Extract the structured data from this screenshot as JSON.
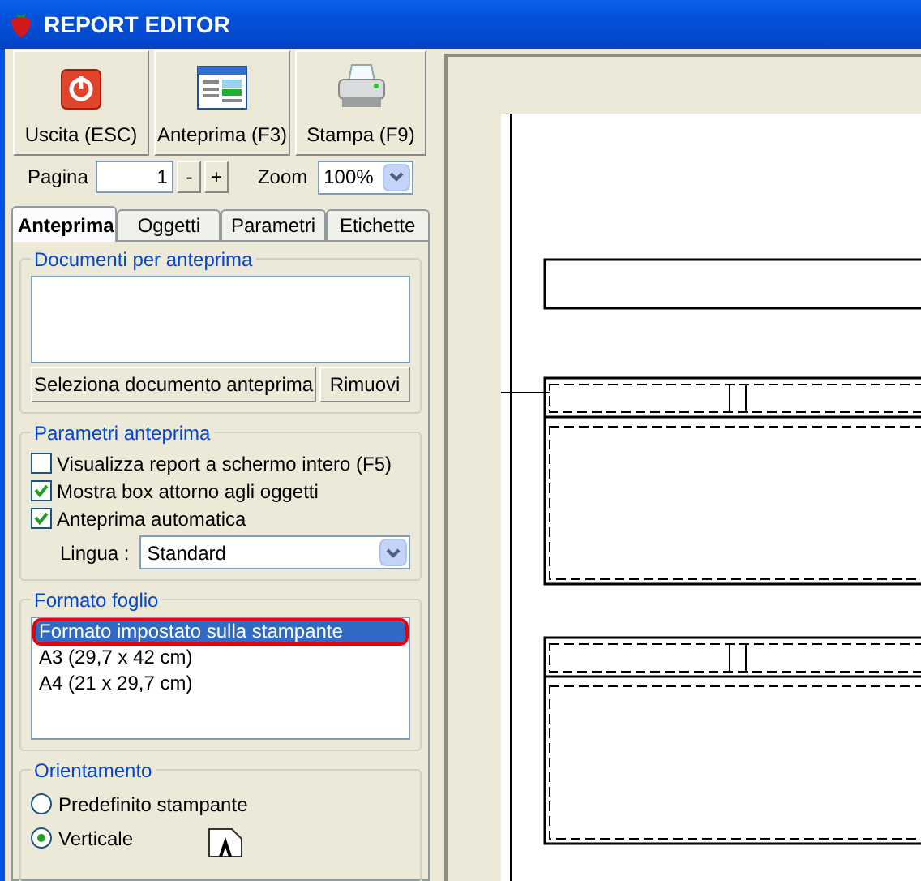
{
  "window": {
    "title": "REPORT EDITOR"
  },
  "toolbar": [
    {
      "kind": "exit",
      "label": "Uscita (ESC)"
    },
    {
      "kind": "preview",
      "label": "Anteprima (F3)"
    },
    {
      "kind": "print",
      "label": "Stampa (F9)"
    }
  ],
  "page_field": {
    "label": "Pagina",
    "value": "1",
    "decrement": "-",
    "increment": "+"
  },
  "zoom": {
    "label": "Zoom",
    "value": "100%"
  },
  "tabs": [
    {
      "label": "Anteprima",
      "selected": true
    },
    {
      "label": "Oggetti",
      "selected": false
    },
    {
      "label": "Parametri",
      "selected": false
    },
    {
      "label": "Etichette",
      "selected": false
    }
  ],
  "documents": {
    "title": "Documenti per anteprima",
    "buttons": [
      "Seleziona documento anteprima",
      "Rimuovi"
    ]
  },
  "preview_params": {
    "title": "Parametri anteprima",
    "options": [
      {
        "label": "Visualizza report a schermo intero (F5)",
        "checked": false
      },
      {
        "label": "Mostra box attorno agli oggetti",
        "checked": true
      },
      {
        "label": "Anteprima automatica",
        "checked": true
      }
    ],
    "language": {
      "label": "Lingua :",
      "value": "Standard"
    }
  },
  "sheet_format": {
    "title": "Formato foglio",
    "items": [
      {
        "label": "Formato impostato sulla stampante",
        "selected": true,
        "highlighted": true
      },
      {
        "label": "A3 (29,7 x 42 cm)",
        "selected": false,
        "highlighted": false
      },
      {
        "label": "A4 (21 x 29,7 cm)",
        "selected": false,
        "highlighted": false
      }
    ]
  },
  "orientation": {
    "title": "Orientamento",
    "options": [
      {
        "label": "Predefinito stampante",
        "selected": false
      },
      {
        "label": "Verticale",
        "selected": true
      }
    ]
  }
}
